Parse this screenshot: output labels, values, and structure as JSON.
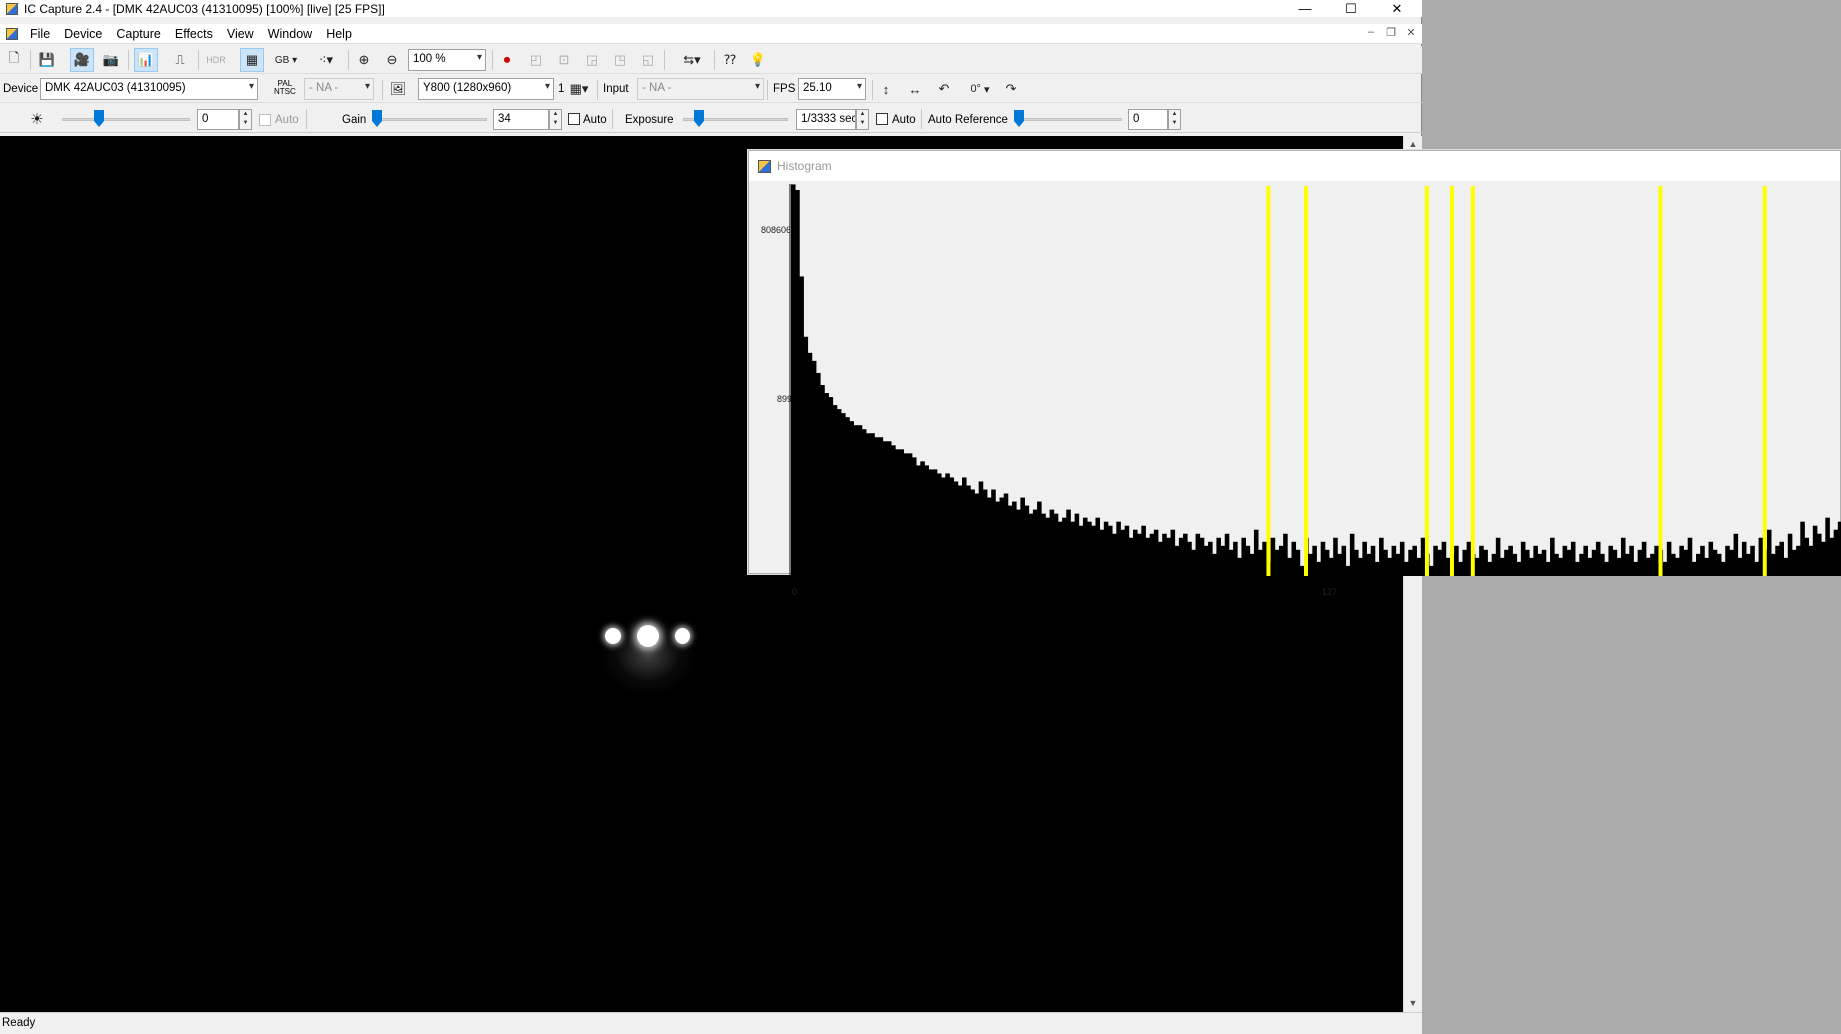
{
  "window": {
    "title": "IC Capture 2.4 - [DMK 42AUC03 (41310095) [100%]  [live]  [25 FPS]]",
    "controls": [
      "—",
      "☐",
      "✕"
    ]
  },
  "menu": {
    "items": [
      "File",
      "Device",
      "Capture",
      "Effects",
      "View",
      "Window",
      "Help"
    ],
    "mdi_controls": [
      "–",
      "❐",
      "✕"
    ]
  },
  "toolbar": {
    "zoom_value": "100 %",
    "color_format_label": "GB"
  },
  "device_bar": {
    "device_label": "Device",
    "device_value": "DMK 42AUC03 (41310095)",
    "video_norm_label_top": "PAL",
    "video_norm_label_bottom": "NTSC",
    "video_norm_value": "- NA -",
    "format_value": "Y800 (1280x960)",
    "binning_value": "1",
    "input_label": "Input",
    "input_value": "- NA -",
    "fps_label": "FPS",
    "fps_value": "25.10",
    "rotation_value": "0°"
  },
  "properties_bar": {
    "brightness_value": "0",
    "brightness_level": 0.27,
    "brightness_auto_label": "Auto",
    "gain_label": "Gain",
    "gain_value": "34",
    "gain_level": 0.0,
    "gain_auto_label": "Auto",
    "exposure_label": "Exposure",
    "exposure_value": "1/3333 sec",
    "exposure_level": 0.12,
    "exposure_auto_label": "Auto",
    "auto_reference_label": "Auto Reference",
    "auto_reference_value": "0",
    "auto_reference_level": 0.0
  },
  "status": {
    "text": "Ready"
  },
  "histogram": {
    "title": "Histogram",
    "y_max_label": "808606",
    "y_mid_label": "899",
    "x_min_label": "0",
    "x_mid_label": "127"
  },
  "chart_data": {
    "type": "bar",
    "x_range": [
      0,
      255
    ],
    "y_labels": [
      "808606",
      "899"
    ],
    "x_labels": [
      "0",
      "127"
    ],
    "bar_color": "#000000",
    "marker_color": "#ffff00",
    "marker_bins": [
      114,
      123,
      152,
      158,
      163,
      208,
      233
    ],
    "values": [
      0.999,
      0.985,
      0.77,
      0.62,
      0.58,
      0.56,
      0.53,
      0.5,
      0.48,
      0.47,
      0.45,
      0.44,
      0.43,
      0.42,
      0.41,
      0.4,
      0.4,
      0.39,
      0.38,
      0.38,
      0.37,
      0.37,
      0.36,
      0.36,
      0.35,
      0.34,
      0.34,
      0.33,
      0.33,
      0.32,
      0.3,
      0.31,
      0.3,
      0.29,
      0.29,
      0.28,
      0.27,
      0.28,
      0.27,
      0.26,
      0.25,
      0.27,
      0.25,
      0.24,
      0.23,
      0.26,
      0.24,
      0.22,
      0.24,
      0.21,
      0.22,
      0.23,
      0.2,
      0.21,
      0.19,
      0.22,
      0.2,
      0.18,
      0.19,
      0.21,
      0.18,
      0.17,
      0.19,
      0.18,
      0.16,
      0.17,
      0.19,
      0.16,
      0.18,
      0.15,
      0.17,
      0.16,
      0.15,
      0.17,
      0.14,
      0.16,
      0.15,
      0.13,
      0.16,
      0.14,
      0.15,
      0.12,
      0.14,
      0.13,
      0.15,
      0.12,
      0.13,
      0.14,
      0.11,
      0.13,
      0.12,
      0.14,
      0.1,
      0.12,
      0.13,
      0.11,
      0.09,
      0.13,
      0.12,
      0.1,
      0.11,
      0.08,
      0.12,
      0.1,
      0.13,
      0.09,
      0.11,
      0.07,
      0.12,
      0.1,
      0.08,
      0.14,
      0.09,
      0.11,
      0.06,
      0.12,
      0.09,
      0.1,
      0.13,
      0.07,
      0.11,
      0.09,
      0.05,
      0.12,
      0.08,
      0.1,
      0.06,
      0.11,
      0.09,
      0.07,
      0.12,
      0.08,
      0.1,
      0.05,
      0.13,
      0.09,
      0.07,
      0.11,
      0.08,
      0.1,
      0.06,
      0.12,
      0.09,
      0.07,
      0.1,
      0.08,
      0.11,
      0.06,
      0.09,
      0.1,
      0.07,
      0.12,
      0.08,
      0.05,
      0.1,
      0.09,
      0.11,
      0.07,
      0.08,
      0.1,
      0.06,
      0.09,
      0.11,
      0.08,
      0.07,
      0.1,
      0.09,
      0.06,
      0.08,
      0.12,
      0.07,
      0.09,
      0.1,
      0.08,
      0.06,
      0.11,
      0.09,
      0.07,
      0.1,
      0.08,
      0.09,
      0.06,
      0.12,
      0.08,
      0.07,
      0.1,
      0.09,
      0.11,
      0.06,
      0.08,
      0.1,
      0.07,
      0.09,
      0.11,
      0.08,
      0.06,
      0.1,
      0.09,
      0.07,
      0.12,
      0.08,
      0.1,
      0.06,
      0.09,
      0.11,
      0.07,
      0.08,
      0.1,
      0.09,
      0.06,
      0.11,
      0.08,
      0.07,
      0.1,
      0.09,
      0.12,
      0.06,
      0.08,
      0.1,
      0.07,
      0.11,
      0.09,
      0.08,
      0.06,
      0.1,
      0.09,
      0.13,
      0.07,
      0.11,
      0.08,
      0.1,
      0.06,
      0.12,
      0.09,
      0.14,
      0.08,
      0.1,
      0.11,
      0.07,
      0.13,
      0.09,
      0.1,
      0.16,
      0.12,
      0.1,
      0.15,
      0.13,
      0.11,
      0.17,
      0.12,
      0.14,
      0.16
    ]
  }
}
